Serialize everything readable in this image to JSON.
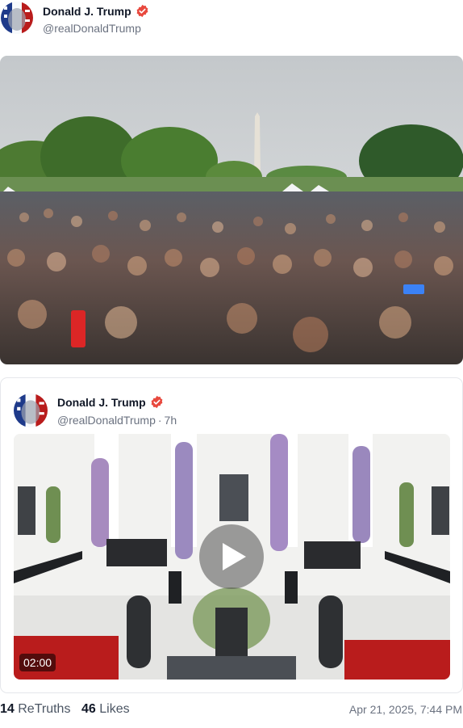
{
  "post": {
    "author_name": "Donald J. Trump",
    "author_handle": "@realDonaldTrump",
    "verified_icon": "verified-badge-icon",
    "verified_color": "#e8493e"
  },
  "media": {
    "photo_icon": "crowd-photo"
  },
  "quoted_post": {
    "author_name": "Donald J. Trump",
    "author_handle": "@realDonaldTrump",
    "separator": "·",
    "age": "7h",
    "video": {
      "duration": "02:00",
      "play_icon": "play-icon"
    }
  },
  "footer": {
    "retruths_count": "14",
    "retruths_label": "ReTruths",
    "likes_count": "46",
    "likes_label": "Likes",
    "timestamp": "Apr 21, 2025, 7:44 PM"
  }
}
